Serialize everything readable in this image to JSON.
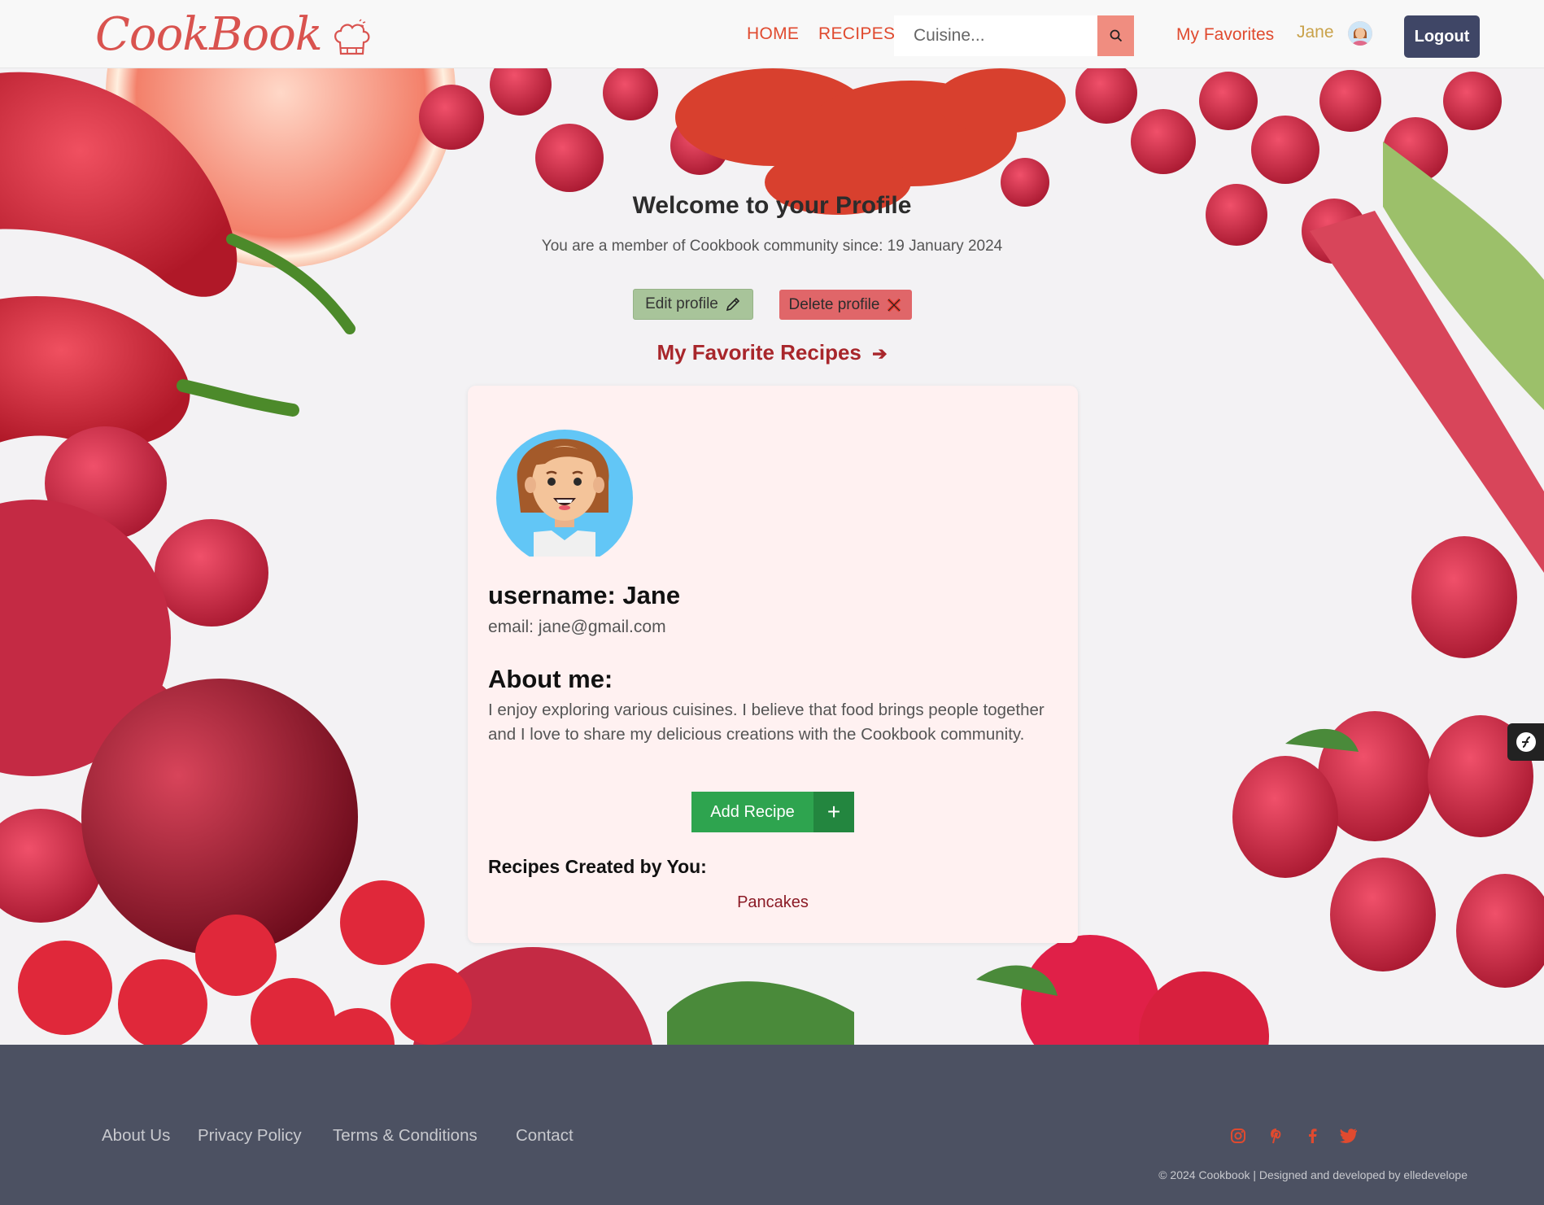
{
  "nav": {
    "brand": "CookBook",
    "home": "HOME",
    "recipes": "RECIPES",
    "search_placeholder": "Cuisine...",
    "favorites": "My Favorites",
    "user": "Jane",
    "logout": "Logout"
  },
  "profile": {
    "welcome": "Welcome to your Profile",
    "member_since": "You are a member of Cookbook community since: 19 January 2024",
    "edit_label": "Edit profile",
    "delete_label": "Delete profile",
    "favorites_link": "My Favorite Recipes",
    "favorites_arrow": "➔"
  },
  "card": {
    "username": "username: Jane",
    "email": "email: jane@gmail.com",
    "about_title": "About me:",
    "about_text": "I enjoy exploring various cuisines. I believe that food brings people together and I love to share my delicious creations with the Cookbook community.",
    "add_recipe": "Add Recipe",
    "add_plus": "+",
    "created_title": "Recipes Created by You:",
    "recipes": [
      "Pancakes"
    ]
  },
  "footer": {
    "links": [
      "About Us",
      "Privacy Policy",
      "Terms & Conditions",
      "Contact"
    ],
    "social": [
      "instagram-icon",
      "pinterest-icon",
      "facebook-icon",
      "twitter-icon"
    ],
    "copyright": "© 2024 Cookbook | Designed and developed by elledevelope"
  },
  "colors": {
    "brand": "#d9534f",
    "nav_link": "#e04a2f",
    "logout_bg": "#3f4666",
    "card_bg": "#fff1f1",
    "add_recipe": "#2ea44f",
    "footer_bg": "#4c5162",
    "social": "#e04a2f"
  }
}
